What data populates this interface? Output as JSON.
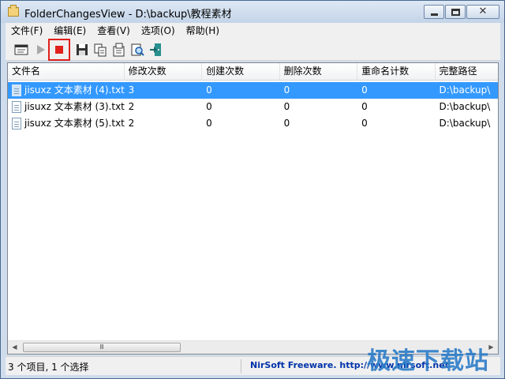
{
  "window": {
    "title": "FolderChangesView  -  D:\\backup\\教程素材"
  },
  "menu": {
    "items": [
      "文件(F)",
      "编辑(E)",
      "查看(V)",
      "选项(O)",
      "帮助(H)"
    ]
  },
  "toolbar": {
    "icons": [
      "properties-window-icon",
      "play-icon",
      "stop-icon",
      "save-icon",
      "copy-icon",
      "html-report-icon",
      "find-icon",
      "exit-icon"
    ],
    "stop_color": "#e0201b"
  },
  "list": {
    "columns": [
      "文件名",
      "修改次数",
      "创建次数",
      "删除次数",
      "重命名计数",
      "完整路径"
    ],
    "rows": [
      {
        "name": "jisuxz 文本素材 (4).txt",
        "modified": "3",
        "created": "0",
        "deleted": "0",
        "renamed": "0",
        "path": "D:\\backup\\"
      },
      {
        "name": "jisuxz 文本素材 (3).txt",
        "modified": "2",
        "created": "0",
        "deleted": "0",
        "renamed": "0",
        "path": "D:\\backup\\"
      },
      {
        "name": "jisuxz 文本素材 (5).txt",
        "modified": "2",
        "created": "0",
        "deleted": "0",
        "renamed": "0",
        "path": "D:\\backup\\"
      }
    ],
    "scroll_thumb": "Ⅲ"
  },
  "status": {
    "left": "3 个项目, 1 个选择",
    "right": "NirSoft Freeware.  http://www.nirsoft.net"
  },
  "watermark": "极速下载站",
  "colors": {
    "selection": "#3399ff",
    "link": "#0033aa",
    "watermark": "#2c7cc8"
  }
}
